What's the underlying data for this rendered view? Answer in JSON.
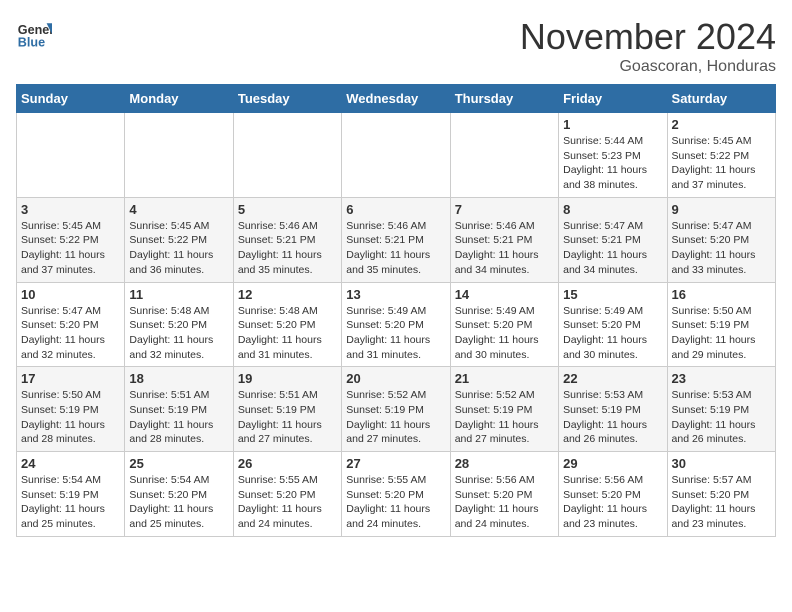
{
  "header": {
    "logo_general": "General",
    "logo_blue": "Blue",
    "month_title": "November 2024",
    "subtitle": "Goascoran, Honduras"
  },
  "days_of_week": [
    "Sunday",
    "Monday",
    "Tuesday",
    "Wednesday",
    "Thursday",
    "Friday",
    "Saturday"
  ],
  "weeks": [
    [
      {
        "day": "",
        "info": ""
      },
      {
        "day": "",
        "info": ""
      },
      {
        "day": "",
        "info": ""
      },
      {
        "day": "",
        "info": ""
      },
      {
        "day": "",
        "info": ""
      },
      {
        "day": "1",
        "info": "Sunrise: 5:44 AM\nSunset: 5:23 PM\nDaylight: 11 hours and 38 minutes."
      },
      {
        "day": "2",
        "info": "Sunrise: 5:45 AM\nSunset: 5:22 PM\nDaylight: 11 hours and 37 minutes."
      }
    ],
    [
      {
        "day": "3",
        "info": "Sunrise: 5:45 AM\nSunset: 5:22 PM\nDaylight: 11 hours and 37 minutes."
      },
      {
        "day": "4",
        "info": "Sunrise: 5:45 AM\nSunset: 5:22 PM\nDaylight: 11 hours and 36 minutes."
      },
      {
        "day": "5",
        "info": "Sunrise: 5:46 AM\nSunset: 5:21 PM\nDaylight: 11 hours and 35 minutes."
      },
      {
        "day": "6",
        "info": "Sunrise: 5:46 AM\nSunset: 5:21 PM\nDaylight: 11 hours and 35 minutes."
      },
      {
        "day": "7",
        "info": "Sunrise: 5:46 AM\nSunset: 5:21 PM\nDaylight: 11 hours and 34 minutes."
      },
      {
        "day": "8",
        "info": "Sunrise: 5:47 AM\nSunset: 5:21 PM\nDaylight: 11 hours and 34 minutes."
      },
      {
        "day": "9",
        "info": "Sunrise: 5:47 AM\nSunset: 5:20 PM\nDaylight: 11 hours and 33 minutes."
      }
    ],
    [
      {
        "day": "10",
        "info": "Sunrise: 5:47 AM\nSunset: 5:20 PM\nDaylight: 11 hours and 32 minutes."
      },
      {
        "day": "11",
        "info": "Sunrise: 5:48 AM\nSunset: 5:20 PM\nDaylight: 11 hours and 32 minutes."
      },
      {
        "day": "12",
        "info": "Sunrise: 5:48 AM\nSunset: 5:20 PM\nDaylight: 11 hours and 31 minutes."
      },
      {
        "day": "13",
        "info": "Sunrise: 5:49 AM\nSunset: 5:20 PM\nDaylight: 11 hours and 31 minutes."
      },
      {
        "day": "14",
        "info": "Sunrise: 5:49 AM\nSunset: 5:20 PM\nDaylight: 11 hours and 30 minutes."
      },
      {
        "day": "15",
        "info": "Sunrise: 5:49 AM\nSunset: 5:20 PM\nDaylight: 11 hours and 30 minutes."
      },
      {
        "day": "16",
        "info": "Sunrise: 5:50 AM\nSunset: 5:19 PM\nDaylight: 11 hours and 29 minutes."
      }
    ],
    [
      {
        "day": "17",
        "info": "Sunrise: 5:50 AM\nSunset: 5:19 PM\nDaylight: 11 hours and 28 minutes."
      },
      {
        "day": "18",
        "info": "Sunrise: 5:51 AM\nSunset: 5:19 PM\nDaylight: 11 hours and 28 minutes."
      },
      {
        "day": "19",
        "info": "Sunrise: 5:51 AM\nSunset: 5:19 PM\nDaylight: 11 hours and 27 minutes."
      },
      {
        "day": "20",
        "info": "Sunrise: 5:52 AM\nSunset: 5:19 PM\nDaylight: 11 hours and 27 minutes."
      },
      {
        "day": "21",
        "info": "Sunrise: 5:52 AM\nSunset: 5:19 PM\nDaylight: 11 hours and 27 minutes."
      },
      {
        "day": "22",
        "info": "Sunrise: 5:53 AM\nSunset: 5:19 PM\nDaylight: 11 hours and 26 minutes."
      },
      {
        "day": "23",
        "info": "Sunrise: 5:53 AM\nSunset: 5:19 PM\nDaylight: 11 hours and 26 minutes."
      }
    ],
    [
      {
        "day": "24",
        "info": "Sunrise: 5:54 AM\nSunset: 5:19 PM\nDaylight: 11 hours and 25 minutes."
      },
      {
        "day": "25",
        "info": "Sunrise: 5:54 AM\nSunset: 5:20 PM\nDaylight: 11 hours and 25 minutes."
      },
      {
        "day": "26",
        "info": "Sunrise: 5:55 AM\nSunset: 5:20 PM\nDaylight: 11 hours and 24 minutes."
      },
      {
        "day": "27",
        "info": "Sunrise: 5:55 AM\nSunset: 5:20 PM\nDaylight: 11 hours and 24 minutes."
      },
      {
        "day": "28",
        "info": "Sunrise: 5:56 AM\nSunset: 5:20 PM\nDaylight: 11 hours and 24 minutes."
      },
      {
        "day": "29",
        "info": "Sunrise: 5:56 AM\nSunset: 5:20 PM\nDaylight: 11 hours and 23 minutes."
      },
      {
        "day": "30",
        "info": "Sunrise: 5:57 AM\nSunset: 5:20 PM\nDaylight: 11 hours and 23 minutes."
      }
    ]
  ]
}
